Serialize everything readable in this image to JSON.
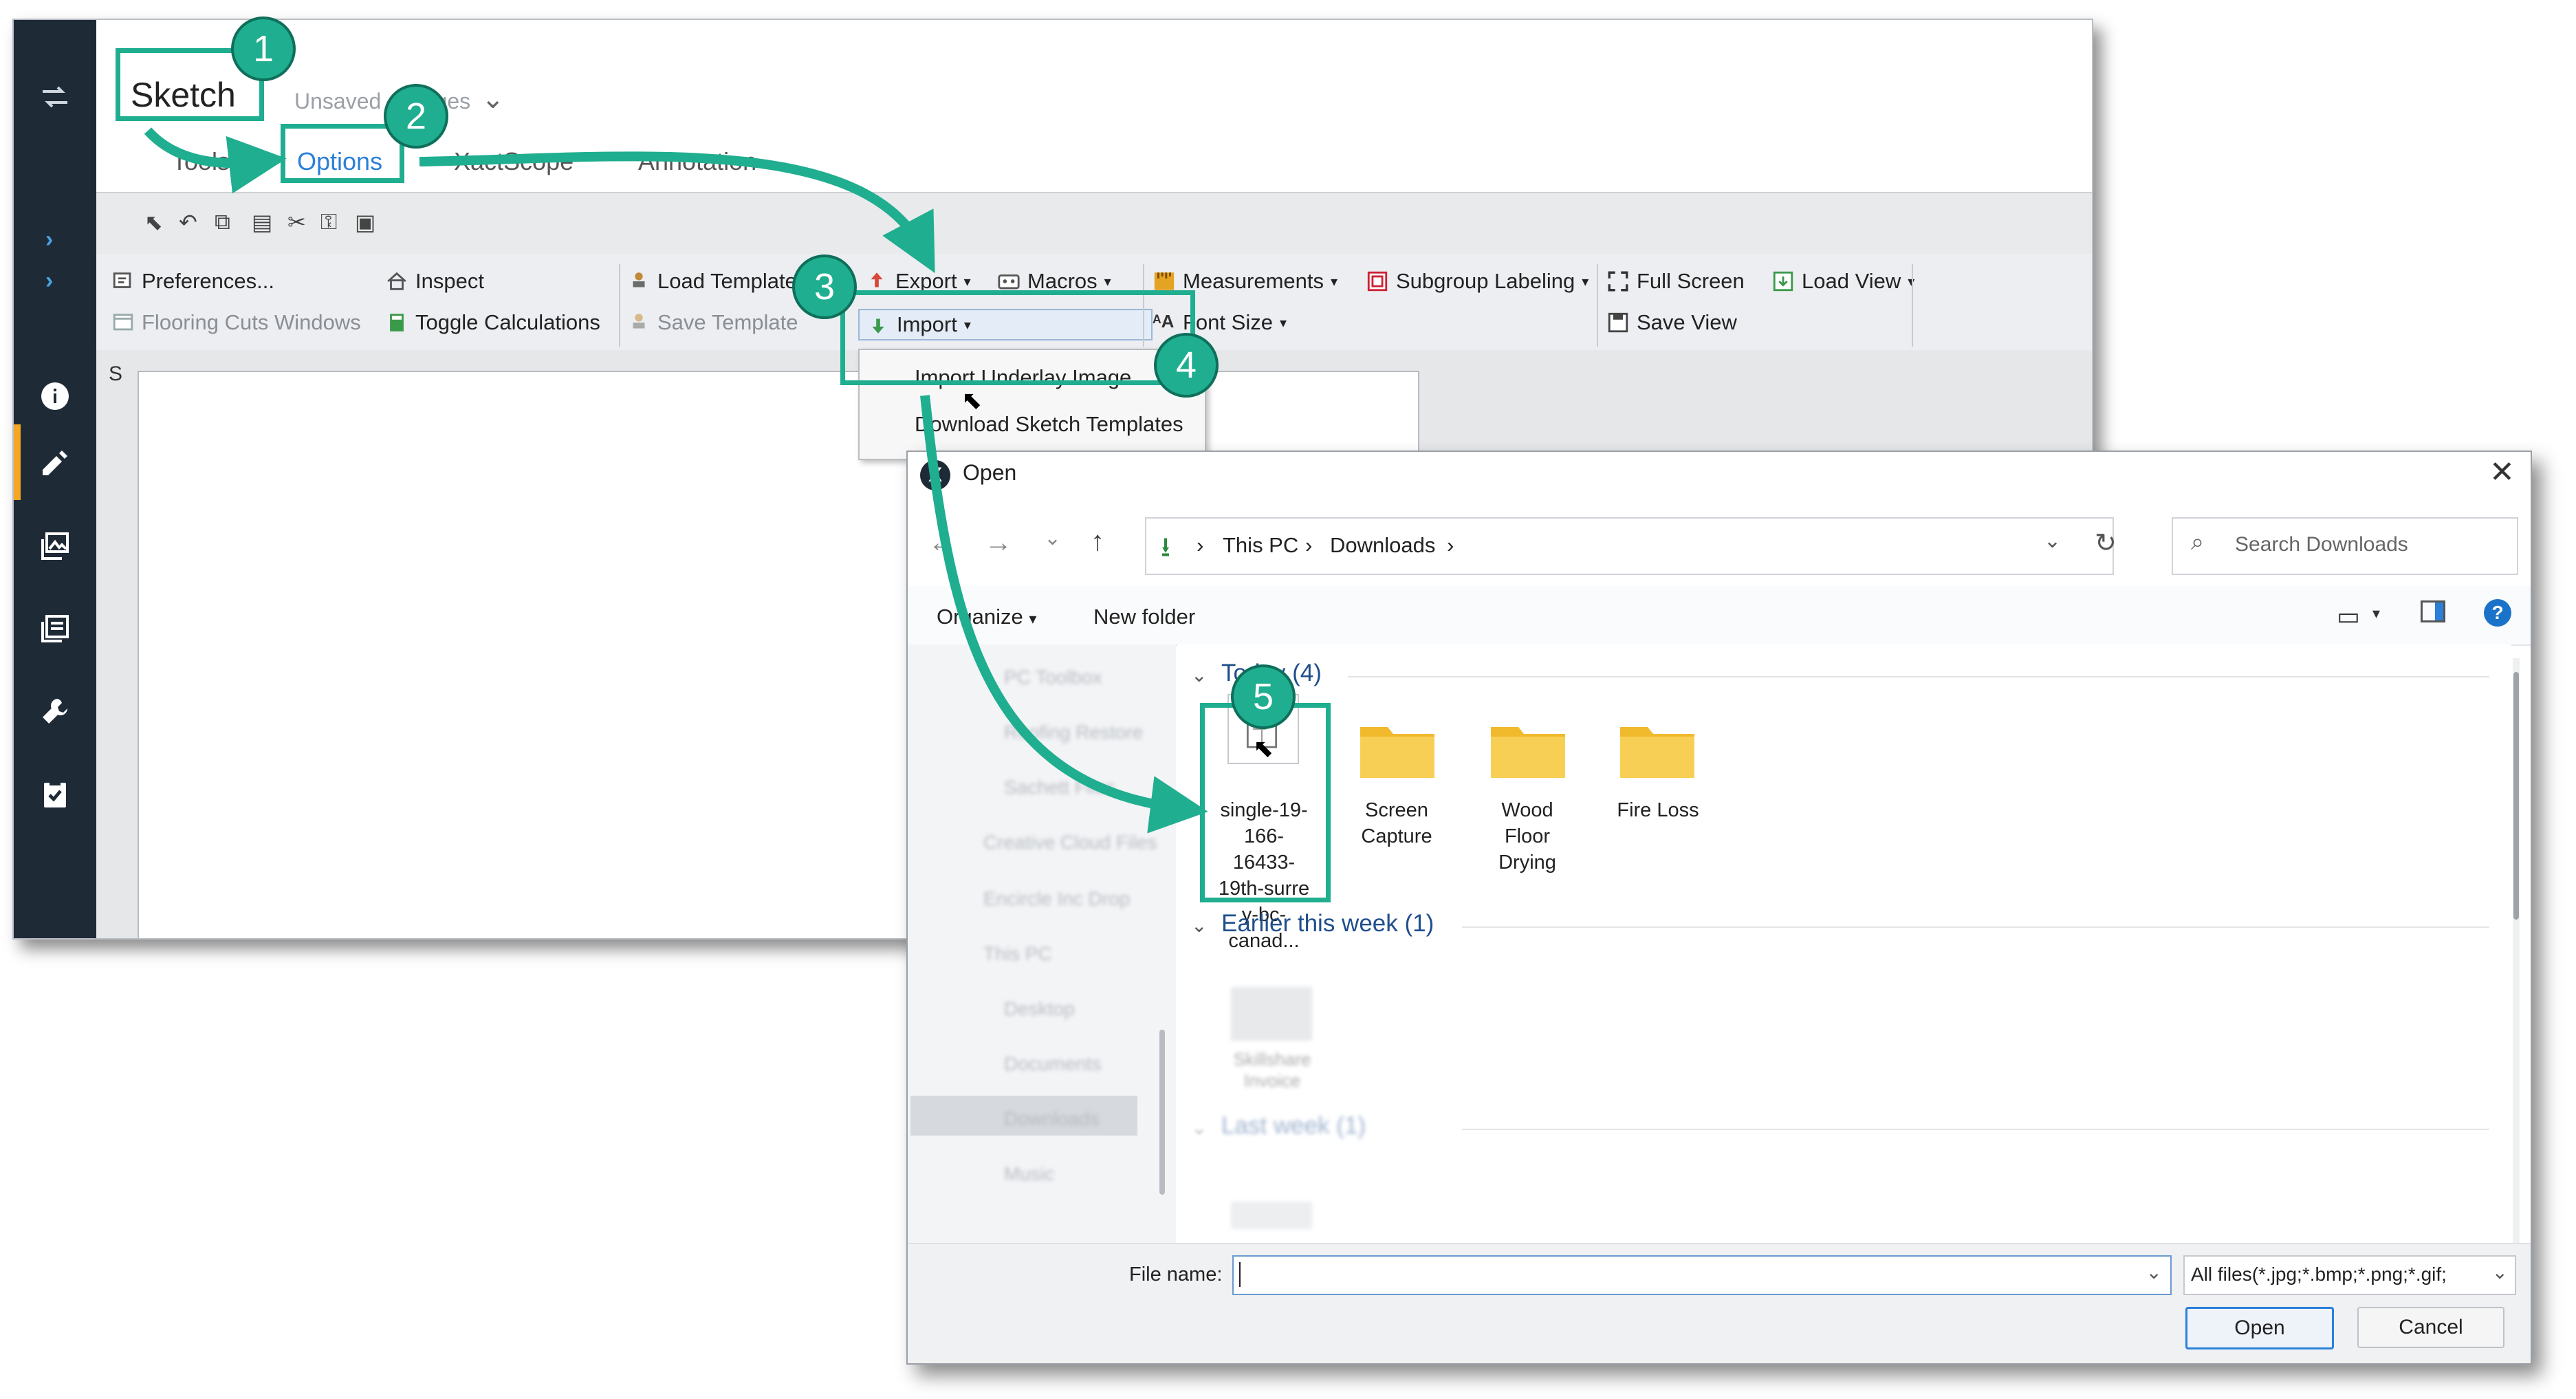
{
  "app": {
    "title": "Sketch",
    "unsaved": "Unsaved changes",
    "tabs": [
      "Tools",
      "Options",
      "XactScope",
      "Annotation"
    ],
    "active_tab": "Options",
    "sketch_label": "S"
  },
  "ribbon": {
    "preferences": "Preferences...",
    "flooring_cuts": "Flooring Cuts Windows",
    "inspect": "Inspect",
    "toggle_calculations": "Toggle Calculations",
    "load_template": "Load Template",
    "save_template": "Save Template",
    "export": "Export",
    "import": "Import",
    "macros": "Macros",
    "measurements": "Measurements",
    "font_size": "Font Size",
    "subgroup_labeling": "Subgroup Labeling",
    "full_screen": "Full Screen",
    "save_view": "Save View",
    "load_view": "Load View"
  },
  "import_menu": {
    "items": [
      "Import Underlay Image",
      "Download Sketch Templates"
    ]
  },
  "dialog": {
    "title": "Open",
    "breadcrumb": [
      "This PC",
      "Downloads"
    ],
    "search_placeholder": "Search Downloads",
    "organize": "Organize",
    "new_folder": "New folder",
    "group_today": "Today (4)",
    "group_earlier": "Earlier this week (1)",
    "group_last_week": "Last week (1)",
    "files": [
      {
        "label": "single-19-166-16433-19th-surrey-bc-canad...",
        "kind": "image"
      },
      {
        "label": "Screen Capture",
        "kind": "folder"
      },
      {
        "label": "Wood Floor Drying",
        "kind": "folder"
      },
      {
        "label": "Fire Loss",
        "kind": "folder"
      }
    ],
    "earlier_file": "Skillshare Invoice",
    "nav_items": [
      "PC Toolbox",
      "Roofing Restore",
      "Sachett Files",
      "Creative Cloud Files",
      "Encircle Inc Drop",
      "This PC",
      "Desktop",
      "Documents",
      "Downloads",
      "Music"
    ],
    "file_name_label": "File name:",
    "file_name_value": "",
    "filter": "All files(*.jpg;*.bmp;*.png;*.gif;",
    "open_button": "Open",
    "cancel_button": "Cancel",
    "help": "?"
  },
  "callouts": [
    "1",
    "2",
    "3",
    "4",
    "5"
  ],
  "colors": {
    "accent": "#1fae8f",
    "sidebar": "#1f2a37",
    "link_blue": "#2b7fd8",
    "folder": "#f7c948"
  }
}
